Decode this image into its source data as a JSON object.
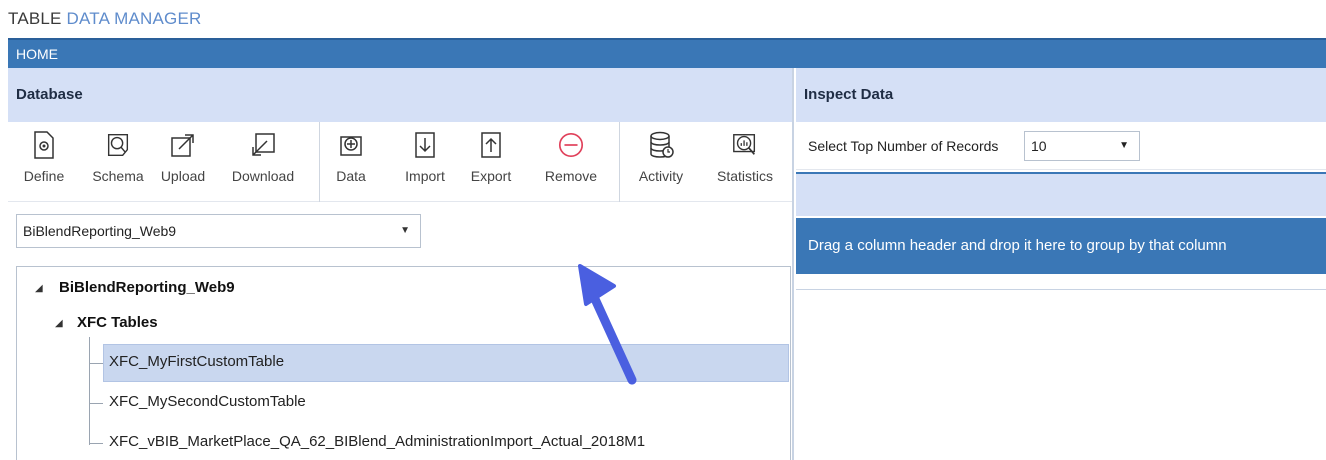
{
  "app": {
    "title_part1": "TABLE",
    "title_part2": "DATA MANAGER"
  },
  "home_bar": {
    "label": "HOME"
  },
  "database_panel": {
    "header": "Database",
    "toolbar": [
      {
        "label": "Define",
        "icon": "define-icon"
      },
      {
        "label": "Schema",
        "icon": "schema-icon"
      },
      {
        "label": "Upload",
        "icon": "upload-icon"
      },
      {
        "label": "Download",
        "icon": "download-icon"
      },
      {
        "label": "Data",
        "icon": "data-add-icon"
      },
      {
        "label": "Import",
        "icon": "import-icon"
      },
      {
        "label": "Export",
        "icon": "export-icon"
      },
      {
        "label": "Remove",
        "icon": "remove-icon"
      },
      {
        "label": "Activity",
        "icon": "activity-icon"
      },
      {
        "label": "Statistics",
        "icon": "statistics-icon"
      }
    ],
    "database_select": {
      "value": "BiBlendReporting_Web9"
    },
    "tree": {
      "root": "BiBlendReporting_Web9",
      "group": "XFC Tables",
      "tables": [
        "XFC_MyFirstCustomTable",
        "XFC_MySecondCustomTable",
        "XFC_vBIB_MarketPlace_QA_62_BIBlend_AdministrationImport_Actual_2018M1"
      ]
    }
  },
  "inspect_panel": {
    "header": "Inspect Data",
    "records_label": "Select Top Number of Records",
    "records_value": "10",
    "group_hint": "Drag a column header and drop it here to group by that column"
  },
  "colors": {
    "accent": "#3a77b6",
    "header_bg": "#d5e0f6",
    "remove_red": "#e0405a",
    "arrow": "#4a5fe0"
  }
}
